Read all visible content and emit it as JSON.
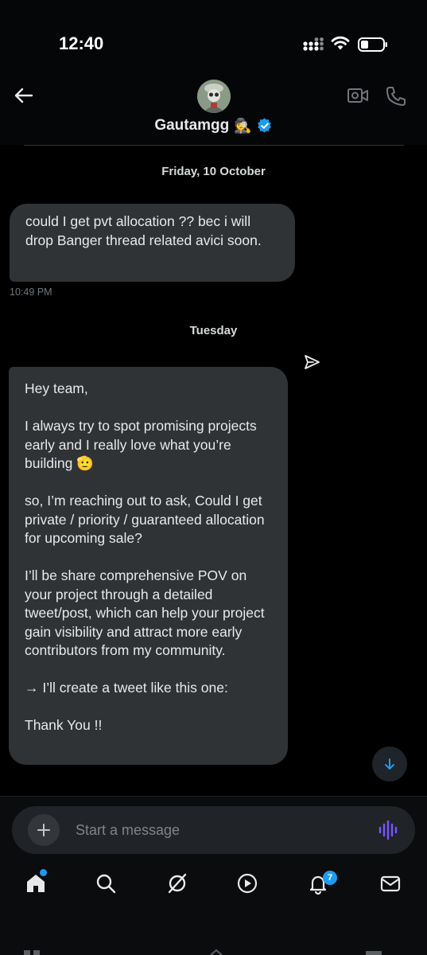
{
  "status_bar": {
    "time": "12:40"
  },
  "header": {
    "contact_name": "Gautamgg",
    "name_emoji": "🕵",
    "icons": [
      "back-arrow-icon",
      "video-call-icon",
      "phone-call-icon",
      "verified-badge-icon"
    ]
  },
  "messages": [
    {
      "date_separator": "Friday, 10 October"
    },
    {
      "text": "could I get pvt allocation ?? bec i will drop Banger thread related avici soon.",
      "timestamp": "10:49 PM"
    },
    {
      "date_separator": "Tuesday"
    },
    {
      "paragraphs": [
        "Hey team,",
        "I always try to spot promising projects early and I really love what you’re building 🫡",
        "so, I’m reaching out to ask, Could I get private / priority / guaranteed allocation for upcoming sale?",
        "I’ll be share comprehensive POV on your project through a detailed tweet/post, which can help your project gain visibility and attract more early contributors from my community.",
        "→ I’ll create a tweet like this one:",
        "Thank You !!"
      ]
    }
  ],
  "composer": {
    "placeholder": "Start a message"
  },
  "bottom_nav": {
    "items": [
      "home",
      "search",
      "grok",
      "video",
      "notifications",
      "messages"
    ],
    "notifications_count": "7"
  },
  "colors": {
    "background": "#000000",
    "bubble": "#2f3336",
    "accent_blue": "#1d9bf0",
    "voice_purple": "#7856ff"
  }
}
